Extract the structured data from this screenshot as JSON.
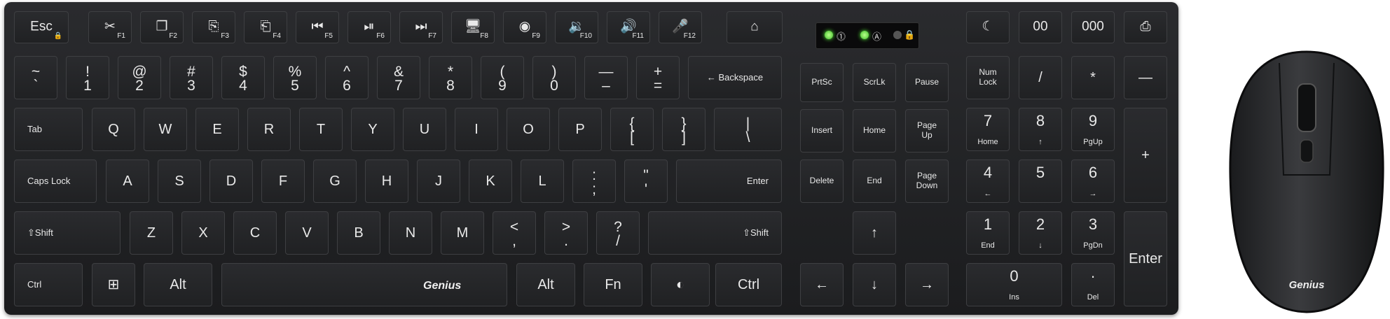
{
  "colors": {
    "key_top": "#2a2b2e",
    "key_text": "#e9e9e9",
    "led_on": "#5cff3a",
    "background": "#ffffff"
  },
  "brand": {
    "keyboard_logo": "Genius",
    "mouse_logo": "Genius"
  },
  "keyboard": {
    "fn_row": [
      {
        "label": "Esc",
        "sub": "🔒"
      },
      {
        "label": "✂",
        "sub": "F1"
      },
      {
        "label": "❐",
        "sub": "F2"
      },
      {
        "label": "⎘",
        "sub": "F3"
      },
      {
        "label": "⎗",
        "sub": "F4"
      },
      {
        "label": "⏮",
        "sub": "F5"
      },
      {
        "label": "⏯",
        "sub": "F6"
      },
      {
        "label": "⏭",
        "sub": "F7"
      },
      {
        "label": "🖥",
        "sub": "F8"
      },
      {
        "label": "◉",
        "sub": "F9"
      },
      {
        "label": "🔉",
        "sub": "F10"
      },
      {
        "label": "🔊",
        "sub": "F11"
      },
      {
        "label": "🎤",
        "sub": "F12"
      },
      {
        "label": "⌂",
        "sub": ""
      }
    ],
    "num_row": [
      {
        "top": "~",
        "bottom": "`"
      },
      {
        "top": "!",
        "bottom": "1"
      },
      {
        "top": "@",
        "bottom": "2"
      },
      {
        "top": "#",
        "bottom": "3"
      },
      {
        "top": "$",
        "bottom": "4"
      },
      {
        "top": "%",
        "bottom": "5"
      },
      {
        "top": "^",
        "bottom": "6"
      },
      {
        "top": "&",
        "bottom": "7"
      },
      {
        "top": "*",
        "bottom": "8"
      },
      {
        "top": "(",
        "bottom": "9"
      },
      {
        "top": ")",
        "bottom": "0"
      },
      {
        "top": "—",
        "bottom": "–"
      },
      {
        "top": "+",
        "bottom": "="
      },
      {
        "top": "← Backspace",
        "bottom": ""
      }
    ],
    "q_row": [
      "Tab",
      "Q",
      "W",
      "E",
      "R",
      "T",
      "Y",
      "U",
      "I",
      "O",
      "P"
    ],
    "q_row_brackets": [
      {
        "top": "{",
        "bottom": "["
      },
      {
        "top": "}",
        "bottom": "]"
      },
      {
        "top": "|",
        "bottom": "\\"
      }
    ],
    "a_row": [
      "Caps Lock",
      "A",
      "S",
      "D",
      "F",
      "G",
      "H",
      "J",
      "K",
      "L"
    ],
    "a_row_punct": [
      {
        "top": ":",
        "bottom": ";"
      },
      {
        "top": "\"",
        "bottom": "'"
      }
    ],
    "a_row_enter": "Enter",
    "z_row": [
      "⇧Shift",
      "Z",
      "X",
      "C",
      "V",
      "B",
      "N",
      "M"
    ],
    "z_row_punct": [
      {
        "top": "<",
        "bottom": ","
      },
      {
        "top": ">",
        "bottom": "."
      },
      {
        "top": "?",
        "bottom": "/"
      }
    ],
    "z_row_shift_right": "⇧Shift",
    "bottom_row": {
      "ctrl_l": "Ctrl",
      "win": "⊞",
      "alt_l": "Alt",
      "alt_r": "Alt",
      "fn": "Fn",
      "copilot": "◐",
      "ctrl_r": "Ctrl"
    },
    "nav_top": [
      "PrtSc",
      "ScrLk",
      "Pause"
    ],
    "nav_mid1": [
      "Insert",
      "Home",
      "Page\nUp"
    ],
    "nav_mid2": [
      "Delete",
      "End",
      "Page\nDown"
    ],
    "arrows": {
      "up": "↑",
      "left": "←",
      "down": "↓",
      "right": "→"
    },
    "numpad_top": [
      "☾",
      "00",
      "000",
      "⎙"
    ],
    "numpad_r1": [
      {
        "top": "Num\nLock",
        "bottom": ""
      },
      {
        "top": "/",
        "bottom": ""
      },
      {
        "top": "*",
        "bottom": ""
      },
      {
        "top": "—",
        "bottom": ""
      }
    ],
    "numpad_r2": [
      {
        "top": "7",
        "bottom": "Home"
      },
      {
        "top": "8",
        "bottom": "↑"
      },
      {
        "top": "9",
        "bottom": "PgUp"
      }
    ],
    "numpad_plus": "+",
    "numpad_r3": [
      {
        "top": "4",
        "bottom": "←"
      },
      {
        "top": "5",
        "bottom": ""
      },
      {
        "top": "6",
        "bottom": "→"
      }
    ],
    "numpad_r4": [
      {
        "top": "1",
        "bottom": "End"
      },
      {
        "top": "2",
        "bottom": "↓"
      },
      {
        "top": "3",
        "bottom": "PgDn"
      }
    ],
    "numpad_enter": "Enter",
    "numpad_r5": [
      {
        "top": "0",
        "bottom": "Ins"
      },
      {
        "top": "·",
        "bottom": "Del"
      }
    ],
    "indicator_icons": [
      "⓵",
      "Ⓐ",
      "🔒"
    ]
  }
}
